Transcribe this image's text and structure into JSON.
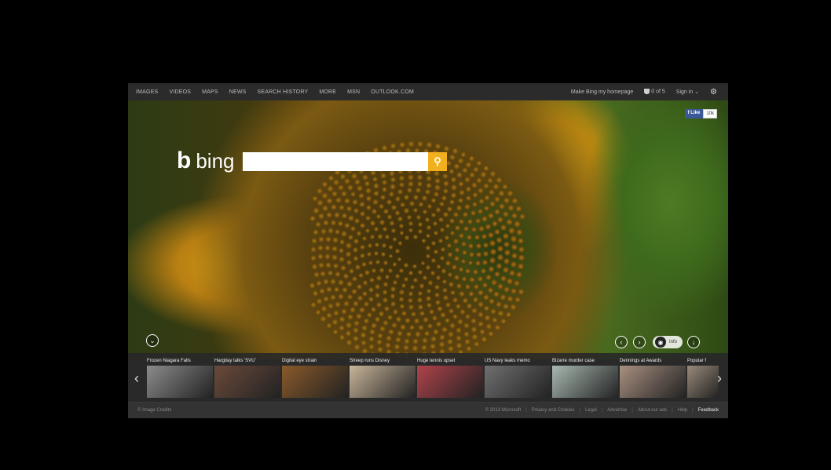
{
  "nav": {
    "items": [
      "IMAGES",
      "VIDEOS",
      "MAPS",
      "NEWS",
      "SEARCH HISTORY",
      "MORE",
      "MSN",
      "OUTLOOK.COM"
    ],
    "homepage": "Make Bing my homepage",
    "rewards": "0 of 5",
    "signin": "Sign in",
    "signin_chevron": "⌄",
    "settings_glyph": "⚙"
  },
  "facebook": {
    "like": "f Like",
    "count": "10k"
  },
  "logo": {
    "mark": "b",
    "word": "bing"
  },
  "search": {
    "value": "",
    "placeholder": "",
    "button_glyph": "⚲"
  },
  "controls": {
    "collapse_glyph": "⌄",
    "prev_glyph": "‹",
    "next_glyph": "›",
    "camera_glyph": "◉",
    "info_label": "Info",
    "download_glyph": "↓"
  },
  "news": {
    "left_arrow": "‹",
    "right_arrow": "›",
    "tiles": [
      {
        "caption": "Frozen Niagara Falls",
        "color": "#8c8c8c"
      },
      {
        "caption": "Hargitay talks 'SVU'",
        "color": "#6b4a3a"
      },
      {
        "caption": "Digital eye strain",
        "color": "#8a5a2a"
      },
      {
        "caption": "Streep runs Disney",
        "color": "#c9b59a"
      },
      {
        "caption": "Huge tennis upset",
        "color": "#b0434b"
      },
      {
        "caption": "US Navy leaks memo",
        "color": "#707070"
      },
      {
        "caption": "Bizarre murder case",
        "color": "#a8b8b0"
      },
      {
        "caption": "Dennings at Awards",
        "color": "#a89080"
      },
      {
        "caption": "Popular f",
        "color": "#9a8a7a"
      }
    ]
  },
  "footer": {
    "credits": "© Image Credits",
    "links": [
      "© 2013 Microsoft",
      "Privacy and Cookies",
      "Legal",
      "Advertise",
      "About our ads",
      "Help",
      "Feedback"
    ]
  }
}
